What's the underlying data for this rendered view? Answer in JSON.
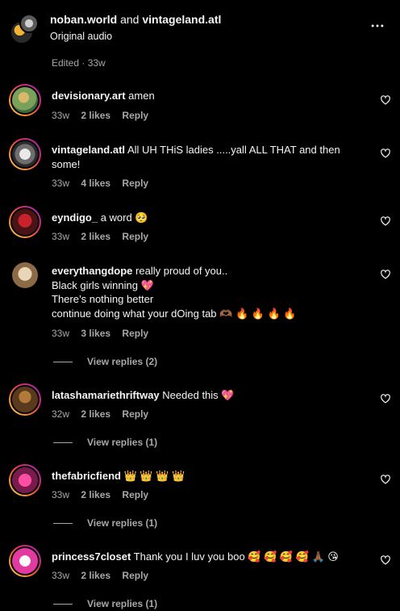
{
  "header": {
    "user1": "noban.world",
    "and_text": "and",
    "user2": "vintageland.atl",
    "subtitle": "Original audio",
    "edited": "Edited · 33w",
    "more_icon": "more-horizontal-icon"
  },
  "comments": [
    {
      "user": "devisionary.art",
      "text": "amen",
      "age": "33w",
      "likes": "2 likes",
      "reply": "Reply",
      "replies": ""
    },
    {
      "user": "vintageland.atl",
      "text": "All UH THiS ladies .....yall ALL THAT and then some!",
      "age": "33w",
      "likes": "4 likes",
      "reply": "Reply",
      "replies": ""
    },
    {
      "user": "eyndigo_",
      "text": "a word 🥺",
      "age": "33w",
      "likes": "2 likes",
      "reply": "Reply",
      "replies": ""
    },
    {
      "user": "everythangdope",
      "text": "really proud of you..\nBlack girls winning 💖\nThere’s nothing better\ncontinue doing what your dOing tab 🫶🏾 🔥 🔥 🔥 🔥",
      "age": "33w",
      "likes": "3 likes",
      "reply": "Reply",
      "replies": "View replies (2)"
    },
    {
      "user": "latashamariethriftway",
      "text": "Needed this 💖",
      "age": "32w",
      "likes": "2 likes",
      "reply": "Reply",
      "replies": "View replies (1)"
    },
    {
      "user": "thefabricfiend",
      "text": "👑 👑 👑 👑",
      "age": "33w",
      "likes": "2 likes",
      "reply": "Reply",
      "replies": "View replies (1)"
    },
    {
      "user": "princess7closet",
      "text": "Thank you I luv you boo 🥰 🥰 🥰 🥰 🙏🏾 😘",
      "age": "33w",
      "likes": "2 likes",
      "reply": "Reply",
      "replies": "View replies (1)"
    }
  ],
  "icons": {
    "like": "heart-outline-icon"
  },
  "colors": {
    "background": "#000000",
    "text": "#f5f5f5",
    "secondary_text": "#a8a8a8"
  }
}
